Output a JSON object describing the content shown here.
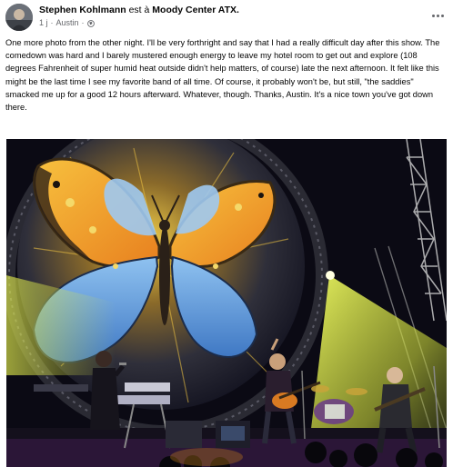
{
  "post": {
    "author": "Stephen Kohlmann",
    "action": " est à ",
    "place": "Moody Center ATX.",
    "time": "1 j",
    "separator": "·",
    "location": "Austin",
    "separator2": "·",
    "privacy_icon": "globe-icon",
    "more_icon": "more-options-icon",
    "text": "One more photo from the other night. I'll be very forthright and say that I had a really difficult day after this show. The comedown was hard and I barely mustered enough energy to leave my hotel room to get out and explore (108 degrees Fahrenheit of super humid heat outside didn't help matters, of course) late the next afternoon. It felt like this might be the last time I see my favorite band of all time. Of course, it probably won't be, but still, \"the saddies\" smacked me up for a good 12 hours afterward. Whatever, though. Thanks, Austin. It's a nice town you've got down there."
  },
  "photo": {
    "description_icon": "concert-photo",
    "colors": {
      "screen_blue": "#3d78c8",
      "wing_orange": "#f2a12c",
      "spotlight": "#d8e63a",
      "stage_dark": "#0b0a14"
    }
  }
}
